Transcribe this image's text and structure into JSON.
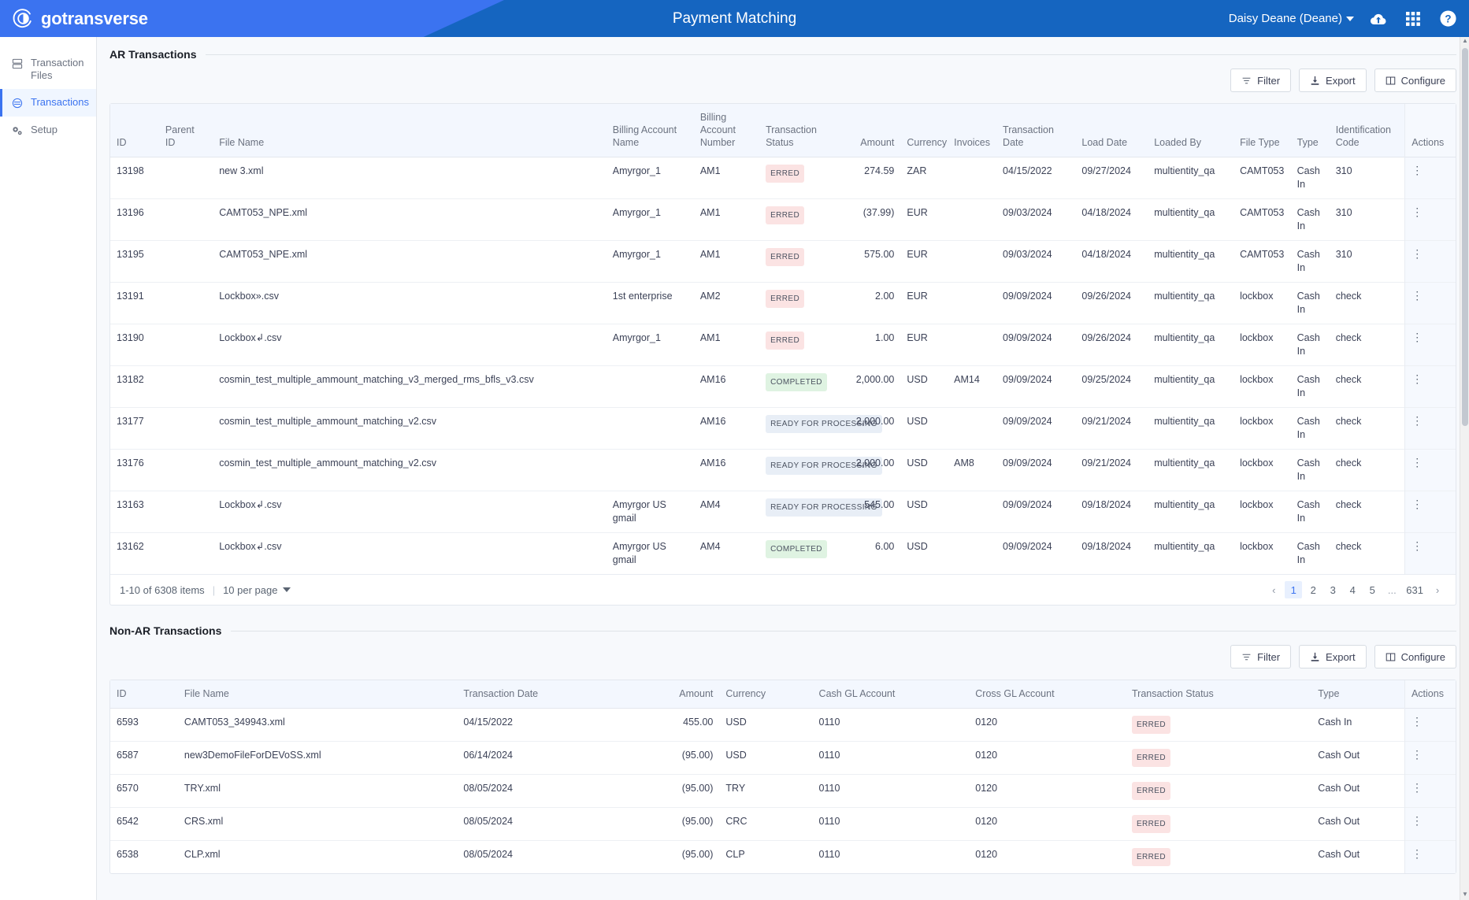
{
  "header": {
    "brand": "gotransverse",
    "brand_logo_icon": "gotransverse-circle-logo",
    "page_title": "Payment Matching",
    "user": "Daisy Deane (Deane)",
    "user_caret_icon": "caret-down-icon",
    "icons": [
      "cloud-upload-icon",
      "apps-grid-icon",
      "help-circle-icon"
    ],
    "colors": {
      "bar": "#1565c0",
      "accent": "#3b73f0"
    }
  },
  "sidebar": {
    "items": [
      {
        "label": "Transaction Files",
        "icon": "transaction-files-icon",
        "active": false
      },
      {
        "label": "Transactions",
        "icon": "transactions-icon",
        "active": true
      },
      {
        "label": "Setup",
        "icon": "setup-gears-icon",
        "active": false
      }
    ]
  },
  "ar_section": {
    "title": "AR Transactions",
    "toolbar": {
      "filter": "Filter",
      "export": "Export",
      "configure": "Configure"
    },
    "columns": [
      "ID",
      "Parent ID",
      "File Name",
      "Billing Account Name",
      "Billing Account Number",
      "Transaction Status",
      "Amount",
      "Currency",
      "Invoices",
      "Transaction Date",
      "Load Date",
      "Loaded By",
      "File Type",
      "Type",
      "Identification Code",
      "Actions"
    ],
    "rows": [
      {
        "id": "13198",
        "parent_id": "",
        "file_name": "new 3.xml",
        "account_name": "Amyrgor_1",
        "account_number": "AM1",
        "status": "ERRED",
        "status_kind": "erred",
        "amount": "274.59",
        "currency": "ZAR",
        "invoices": "",
        "transaction_date": "04/15/2022",
        "load_date": "09/27/2024",
        "loaded_by": "multientity_qa",
        "file_type": "CAMT053",
        "type": "Cash In",
        "identification_code": "310"
      },
      {
        "id": "13196",
        "parent_id": "",
        "file_name": "CAMT053_NPE.xml",
        "account_name": "Amyrgor_1",
        "account_number": "AM1",
        "status": "ERRED",
        "status_kind": "erred",
        "amount": "(37.99)",
        "currency": "EUR",
        "invoices": "",
        "transaction_date": "09/03/2024",
        "load_date": "04/18/2024",
        "loaded_by": "multientity_qa",
        "file_type": "CAMT053",
        "type": "Cash In",
        "identification_code": "310"
      },
      {
        "id": "13195",
        "parent_id": "",
        "file_name": "CAMT053_NPE.xml",
        "account_name": "Amyrgor_1",
        "account_number": "AM1",
        "status": "ERRED",
        "status_kind": "erred",
        "amount": "575.00",
        "currency": "EUR",
        "invoices": "",
        "transaction_date": "09/03/2024",
        "load_date": "04/18/2024",
        "loaded_by": "multientity_qa",
        "file_type": "CAMT053",
        "type": "Cash In",
        "identification_code": "310"
      },
      {
        "id": "13191",
        "parent_id": "",
        "file_name": "Lockbox».csv",
        "account_name": "1st enterprise",
        "account_number": "AM2",
        "status": "ERRED",
        "status_kind": "erred",
        "amount": "2.00",
        "currency": "EUR",
        "invoices": "",
        "transaction_date": "09/09/2024",
        "load_date": "09/26/2024",
        "loaded_by": "multientity_qa",
        "file_type": "lockbox",
        "type": "Cash In",
        "identification_code": "check"
      },
      {
        "id": "13190",
        "parent_id": "",
        "file_name": "Lockbox↲.csv",
        "account_name": "Amyrgor_1",
        "account_number": "AM1",
        "status": "ERRED",
        "status_kind": "erred",
        "amount": "1.00",
        "currency": "EUR",
        "invoices": "",
        "transaction_date": "09/09/2024",
        "load_date": "09/26/2024",
        "loaded_by": "multientity_qa",
        "file_type": "lockbox",
        "type": "Cash In",
        "identification_code": "check"
      },
      {
        "id": "13182",
        "parent_id": "",
        "file_name": "cosmin_test_multiple_ammount_matching_v3_merged_rms_bfls_v3.csv",
        "account_name": "",
        "account_number": "AM16",
        "status": "COMPLETED",
        "status_kind": "completed",
        "amount": "2,000.00",
        "currency": "USD",
        "invoices": "AM14",
        "transaction_date": "09/09/2024",
        "load_date": "09/25/2024",
        "loaded_by": "multientity_qa",
        "file_type": "lockbox",
        "type": "Cash In",
        "identification_code": "check"
      },
      {
        "id": "13177",
        "parent_id": "",
        "file_name": "cosmin_test_multiple_ammount_matching_v2.csv",
        "account_name": "",
        "account_number": "AM16",
        "status": "READY FOR PROCESSING",
        "status_kind": "ready",
        "amount": "2,000.00",
        "currency": "USD",
        "invoices": "",
        "transaction_date": "09/09/2024",
        "load_date": "09/21/2024",
        "loaded_by": "multientity_qa",
        "file_type": "lockbox",
        "type": "Cash In",
        "identification_code": "check"
      },
      {
        "id": "13176",
        "parent_id": "",
        "file_name": "cosmin_test_multiple_ammount_matching_v2.csv",
        "account_name": "",
        "account_number": "AM16",
        "status": "READY FOR PROCESSING",
        "status_kind": "ready",
        "amount": "2,000.00",
        "currency": "USD",
        "invoices": "AM8",
        "transaction_date": "09/09/2024",
        "load_date": "09/21/2024",
        "loaded_by": "multientity_qa",
        "file_type": "lockbox",
        "type": "Cash In",
        "identification_code": "check"
      },
      {
        "id": "13163",
        "parent_id": "",
        "file_name": "Lockbox↲.csv",
        "account_name": "Amyrgor US gmail",
        "account_number": "AM4",
        "status": "READY FOR PROCESSING",
        "status_kind": "ready",
        "amount": "545.00",
        "currency": "USD",
        "invoices": "",
        "transaction_date": "09/09/2024",
        "load_date": "09/18/2024",
        "loaded_by": "multientity_qa",
        "file_type": "lockbox",
        "type": "Cash In",
        "identification_code": "check"
      },
      {
        "id": "13162",
        "parent_id": "",
        "file_name": "Lockbox↲.csv",
        "account_name": "Amyrgor US gmail",
        "account_number": "AM4",
        "status": "COMPLETED",
        "status_kind": "completed",
        "amount": "6.00",
        "currency": "USD",
        "invoices": "",
        "transaction_date": "09/09/2024",
        "load_date": "09/18/2024",
        "loaded_by": "multientity_qa",
        "file_type": "lockbox",
        "type": "Cash In",
        "identification_code": "check"
      }
    ],
    "pagination": {
      "items_label": "1-10 of 6308 items",
      "per_page": "10 per page",
      "prev": "‹",
      "next": "›",
      "pages": [
        "1",
        "2",
        "3",
        "4",
        "5",
        "...",
        "631"
      ],
      "current": "1"
    }
  },
  "nonar_section": {
    "title": "Non-AR Transactions",
    "toolbar": {
      "filter": "Filter",
      "export": "Export",
      "configure": "Configure"
    },
    "columns": [
      "ID",
      "File Name",
      "Transaction Date",
      "Amount",
      "Currency",
      "Cash GL Account",
      "Cross GL Account",
      "Transaction Status",
      "Type",
      "Actions"
    ],
    "rows": [
      {
        "id": "6593",
        "file_name": "CAMT053_349943.xml",
        "transaction_date": "04/15/2022",
        "amount": "455.00",
        "currency": "USD",
        "cash_gl": "0110",
        "cross_gl": "0120",
        "status": "ERRED",
        "status_kind": "erred",
        "type": "Cash In"
      },
      {
        "id": "6587",
        "file_name": "new3DemoFileForDEVoSS.xml",
        "transaction_date": "06/14/2024",
        "amount": "(95.00)",
        "currency": "USD",
        "cash_gl": "0110",
        "cross_gl": "0120",
        "status": "ERRED",
        "status_kind": "erred",
        "type": "Cash Out"
      },
      {
        "id": "6570",
        "file_name": "TRY.xml",
        "transaction_date": "08/05/2024",
        "amount": "(95.00)",
        "currency": "TRY",
        "cash_gl": "0110",
        "cross_gl": "0120",
        "status": "ERRED",
        "status_kind": "erred",
        "type": "Cash Out"
      },
      {
        "id": "6542",
        "file_name": "CRS.xml",
        "transaction_date": "08/05/2024",
        "amount": "(95.00)",
        "currency": "CRC",
        "cash_gl": "0110",
        "cross_gl": "0120",
        "status": "ERRED",
        "status_kind": "erred",
        "type": "Cash Out"
      },
      {
        "id": "6538",
        "file_name": "CLP.xml",
        "transaction_date": "08/05/2024",
        "amount": "(95.00)",
        "currency": "CLP",
        "cash_gl": "0110",
        "cross_gl": "0120",
        "status": "ERRED",
        "status_kind": "erred",
        "type": "Cash Out"
      }
    ]
  }
}
